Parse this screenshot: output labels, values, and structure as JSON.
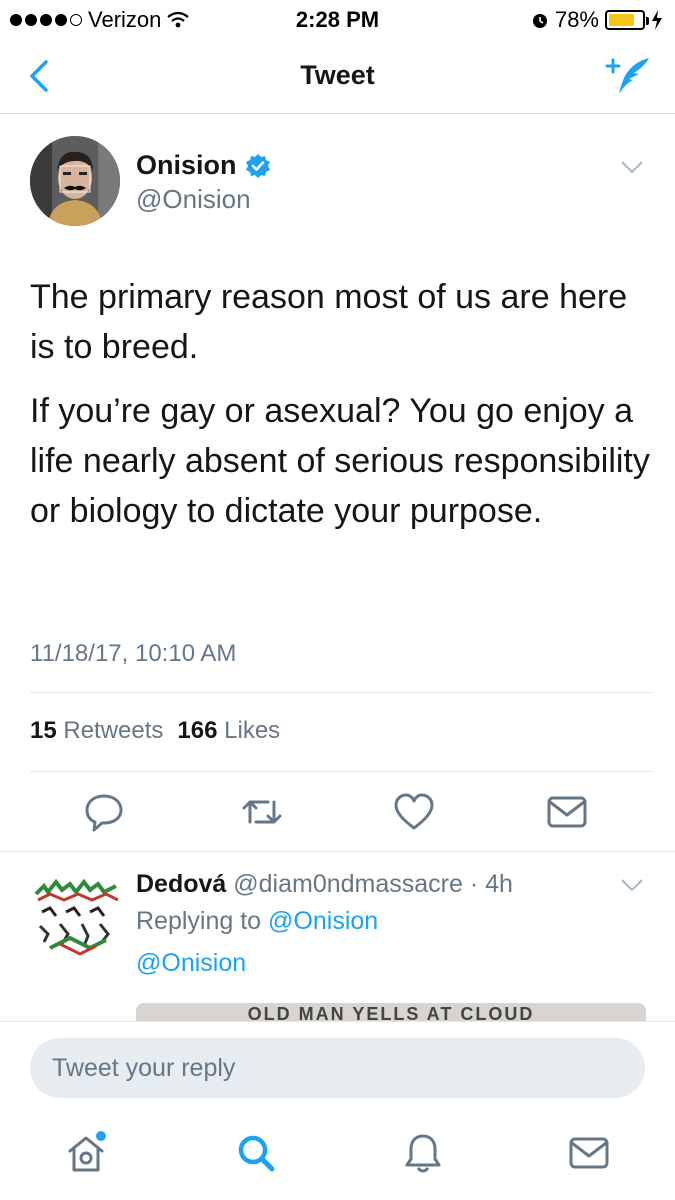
{
  "status_bar": {
    "carrier": "Verizon",
    "time": "2:28 PM",
    "battery_percent": "78%",
    "battery_level": 0.78,
    "signal_bars": 4
  },
  "nav": {
    "title": "Tweet",
    "back_icon": "chevron-left-icon",
    "compose_icon": "compose-feather-icon"
  },
  "tweet": {
    "author_name": "Onision",
    "author_handle": "@Onision",
    "verified": true,
    "paragraphs": [
      "The primary reason most of us are here is to breed.",
      "If you’re gay or asexual? You go enjoy a life nearly absent of serious responsibility or biology to dictate your purpose."
    ],
    "timestamp": "11/18/17, 10:10 AM",
    "retweets_count": "15",
    "retweets_label": "Retweets",
    "likes_count": "166",
    "likes_label": "Likes"
  },
  "actions": [
    "reply-icon",
    "retweet-icon",
    "like-heart-icon",
    "direct-message-icon"
  ],
  "reply": {
    "name": "Dedová",
    "handle_time": "@diam0ndmassacre · 4h",
    "replying_prefix": "Replying to",
    "replying_to": "@Onision",
    "mention": "@Onision",
    "media_caption": "OLD MAN YELLS AT CLOUD"
  },
  "composer": {
    "placeholder": "Tweet your reply"
  },
  "tab_bar": [
    "home-icon",
    "search-icon",
    "notifications-bell-icon",
    "messages-envelope-icon"
  ],
  "colors": {
    "accent": "#1da1f2",
    "secondary_text": "#657786",
    "primary_text": "#14171a",
    "battery": "#f5c518"
  }
}
